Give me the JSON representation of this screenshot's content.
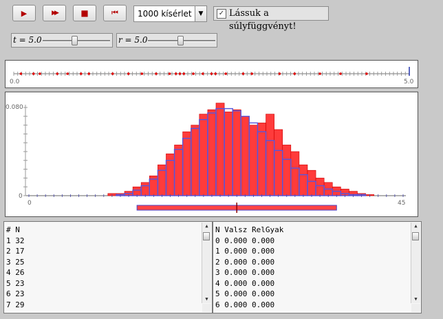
{
  "toolbar": {
    "buttons": [
      {
        "name": "play-button",
        "icon": "play-icon",
        "glyph": "▶"
      },
      {
        "name": "fast-forward-button",
        "icon": "fast-forward-icon",
        "glyph": "▶▶"
      },
      {
        "name": "stop-button",
        "icon": "stop-icon",
        "glyph": "■"
      },
      {
        "name": "reset-button",
        "icon": "skip-back-icon",
        "glyph": "⏮"
      }
    ],
    "trials_select": "1000 kísérlet",
    "checkbox_label": "Lássuk a súlyfüggvényt!",
    "checkbox_checked": true
  },
  "params": {
    "t_label": "t = 5.0",
    "t_value": 5.0,
    "r_label": "r = 5.0",
    "r_value": 5.0
  },
  "timeline": {
    "min_label": "0.0",
    "max_label": "5.0",
    "min": 0,
    "max": 5,
    "events": [
      0.09,
      0.25,
      0.33,
      0.55,
      0.68,
      0.85,
      0.95,
      1.25,
      1.45,
      1.62,
      1.8,
      1.97,
      2.05,
      2.1,
      2.15,
      2.27,
      2.39,
      2.5,
      2.55,
      2.68,
      2.9,
      3.01,
      3.36,
      3.55,
      3.87,
      4.13,
      4.46
    ]
  },
  "chart_data": {
    "type": "bar",
    "x": [
      0,
      1,
      2,
      3,
      4,
      5,
      6,
      7,
      8,
      9,
      10,
      11,
      12,
      13,
      14,
      15,
      16,
      17,
      18,
      19,
      20,
      21,
      22,
      23,
      24,
      25,
      26,
      27,
      28,
      29,
      30,
      31,
      32,
      33,
      34,
      35,
      36,
      37,
      38,
      39,
      40,
      41,
      42,
      43,
      44,
      45
    ],
    "series": [
      {
        "name": "RelGyak",
        "color": "#ff3b3b",
        "values": [
          0,
          0,
          0,
          0,
          0,
          0,
          0,
          0,
          0,
          0,
          0.002,
          0.002,
          0.004,
          0.008,
          0.012,
          0.018,
          0.028,
          0.038,
          0.046,
          0.058,
          0.064,
          0.074,
          0.078,
          0.084,
          0.076,
          0.078,
          0.072,
          0.064,
          0.066,
          0.074,
          0.06,
          0.046,
          0.04,
          0.028,
          0.023,
          0.016,
          0.012,
          0.008,
          0.006,
          0.004,
          0.002,
          0.001,
          0,
          0,
          0,
          0
        ]
      },
      {
        "name": "Valsz",
        "color": "#5555dd",
        "values": [
          0,
          0,
          0,
          0,
          0,
          0,
          0,
          0,
          0,
          0,
          0,
          0.001,
          0.002,
          0.005,
          0.009,
          0.015,
          0.023,
          0.032,
          0.042,
          0.052,
          0.061,
          0.069,
          0.075,
          0.079,
          0.079,
          0.077,
          0.072,
          0.066,
          0.058,
          0.05,
          0.041,
          0.033,
          0.025,
          0.019,
          0.013,
          0.009,
          0.006,
          0.004,
          0.002,
          0.001,
          0.001,
          0,
          0,
          0,
          0,
          0
        ]
      }
    ],
    "ylim": [
      0,
      0.08
    ],
    "y_tick_label": "0.080",
    "y_zero_label": "0",
    "x_min_label": "0",
    "x_max_label": "45",
    "mean_sd_bar": {
      "mean": 25,
      "sd": 5
    }
  },
  "left_table": {
    "header": "# N",
    "rows": [
      "1 32",
      "2 17",
      "3 25",
      "4 26",
      "5 23",
      "6 23",
      "7 29"
    ]
  },
  "right_table": {
    "header": "N Valsz RelGyak",
    "rows": [
      "0 0.000 0.000",
      "1 0.000 0.000",
      "2 0.000 0.000",
      "3 0.000 0.000",
      "4 0.000 0.000",
      "5 0.000 0.000",
      "6 0.000 0.000"
    ]
  }
}
